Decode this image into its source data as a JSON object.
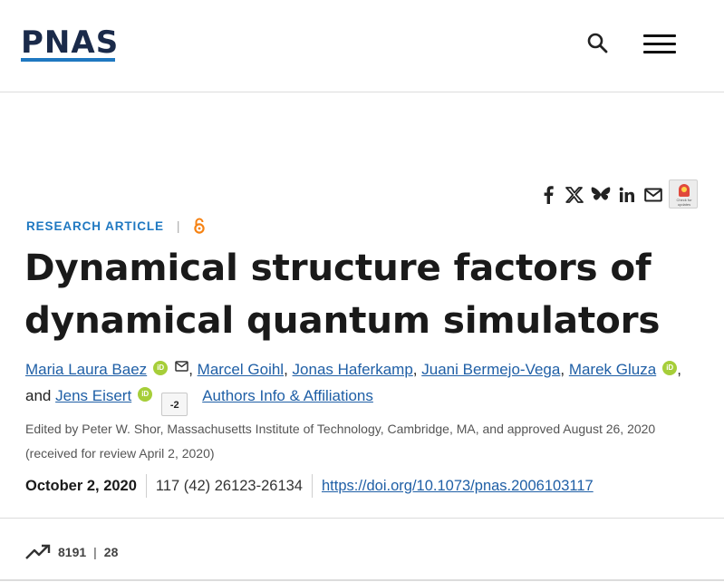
{
  "header": {
    "logo": "PNAS",
    "search_icon": "search-icon",
    "menu_icon": "hamburger-menu-icon"
  },
  "share": {
    "icons": [
      "facebook-icon",
      "x-twitter-icon",
      "bluesky-icon",
      "linkedin-icon",
      "email-icon"
    ],
    "check_updates_text": "Check for updates"
  },
  "article": {
    "type": "RESEARCH ARTICLE",
    "separator": "|",
    "open_access_icon": "open-access-icon",
    "title": "Dynamical structure factors of dynamical quantum simulators",
    "authors": [
      {
        "name": "Maria Laura Baez",
        "orcid": "iD",
        "mail": true
      },
      {
        "name": "Marcel Goihl"
      },
      {
        "name": "Jonas Haferkamp"
      },
      {
        "name": "Juani Bermejo-Vega"
      },
      {
        "name": "Marek Gluza",
        "orcid": "iD"
      },
      {
        "name": "Jens Eisert",
        "orcid": "iD"
      }
    ],
    "comma": ",",
    "and": "and",
    "more_count": "-2",
    "affiliations_link": "Authors Info & Affiliations",
    "edited_by": "Edited by Peter W. Shor, Massachusetts Institute of Technology, Cambridge, MA, and approved August 26, 2020 (received for review April 2, 2020)",
    "date": "October 2, 2020",
    "citation": "117 (42) 26123-26134",
    "doi": "https://doi.org/10.1073/pnas.2006103117"
  },
  "metrics": {
    "icon": "trending-up-icon",
    "views": "8191",
    "separator": "|",
    "citations": "28"
  },
  "colors": {
    "accent": "#1f78c1",
    "link": "#1f5fa6",
    "orcid": "#a6ce39",
    "open_access": "#f68212"
  }
}
